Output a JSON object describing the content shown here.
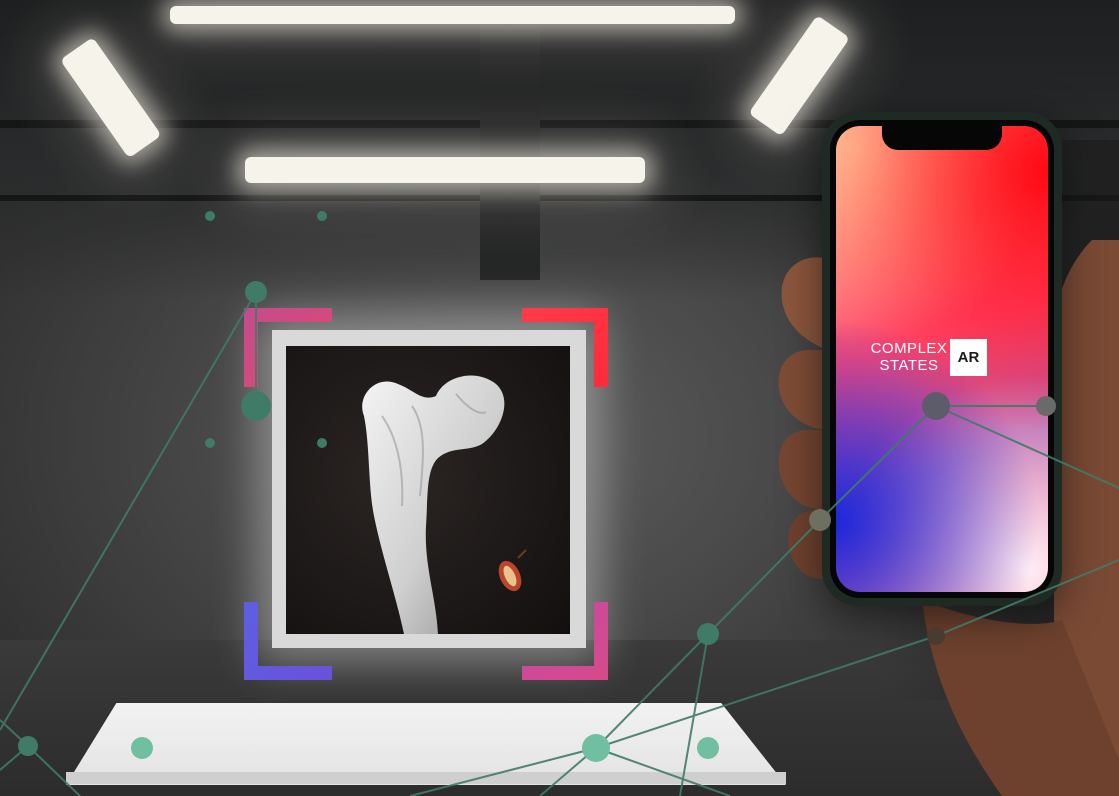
{
  "scene": {
    "app_screen": {
      "brand_line1": "COMPLEX",
      "brand_line2": "STATES",
      "badge": "AR"
    },
    "colors": {
      "network_line": "#3f7b66",
      "network_node": "#6fbfa0",
      "frame_pink": "#e0467a",
      "frame_red": "#ff2a3a",
      "frame_blue": "#5a5ae0",
      "frame_magenta": "#c44aa0"
    }
  }
}
